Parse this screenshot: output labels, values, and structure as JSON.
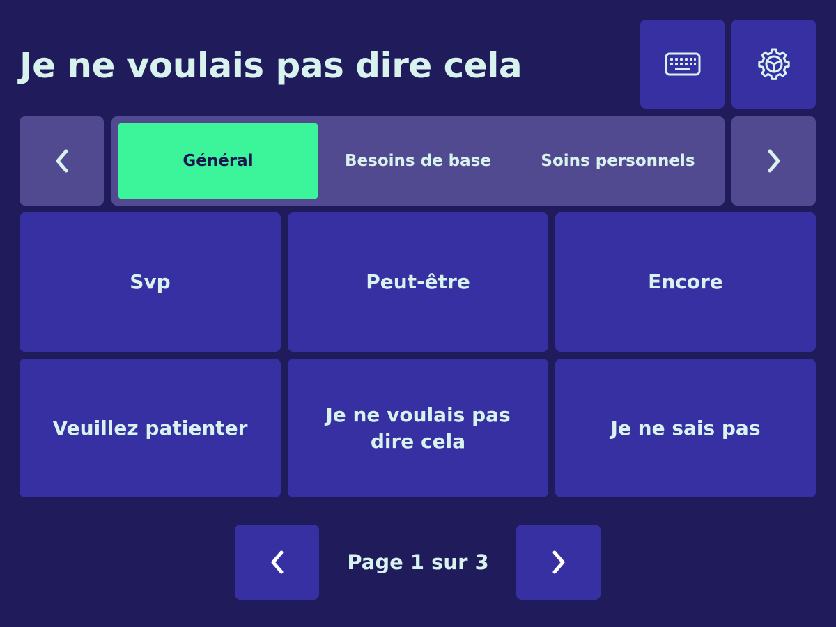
{
  "header": {
    "title": "Je ne voulais pas dire cela",
    "keyboard_icon": "keyboard-icon",
    "settings_icon": "gear-icon"
  },
  "categories": {
    "prev_icon": "chevron-left-icon",
    "next_icon": "chevron-right-icon",
    "tabs": [
      {
        "label": "Général",
        "active": true
      },
      {
        "label": "Besoins de base",
        "active": false
      },
      {
        "label": "Soins personnels",
        "active": false
      }
    ]
  },
  "phrases": [
    {
      "label": "Svp"
    },
    {
      "label": "Peut-être"
    },
    {
      "label": "Encore"
    },
    {
      "label": "Veuillez patienter"
    },
    {
      "label": "Je ne voulais pas dire cela"
    },
    {
      "label": "Je ne sais pas"
    }
  ],
  "pagination": {
    "label": "Page 1 sur 3",
    "current_page": 1,
    "total_pages": 3
  },
  "colors": {
    "background": "#201c5c",
    "tile": "#3730a3",
    "muted_tile": "#524a91",
    "active_tab": "#3cf59b",
    "text": "#d8f2ee"
  }
}
